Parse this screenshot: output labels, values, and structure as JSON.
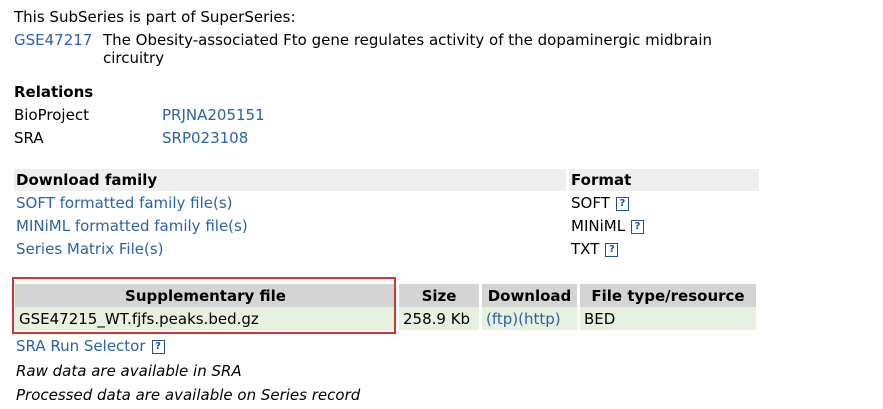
{
  "superseries": {
    "intro": "This SubSeries is part of SuperSeries:",
    "accession": "GSE47217",
    "title_line1": "The Obesity-associated Fto gene regulates activity of the dopaminergic midbrain",
    "title_line2": "circuitry"
  },
  "relations": {
    "heading": "Relations",
    "rows": [
      {
        "label": "BioProject",
        "value": "PRJNA205151"
      },
      {
        "label": "SRA",
        "value": "SRP023108"
      }
    ]
  },
  "download_family": {
    "col_family": "Download family",
    "col_format": "Format",
    "rows": [
      {
        "label": "SOFT formatted family file(s)",
        "format": "SOFT"
      },
      {
        "label": "MINiML formatted family file(s)",
        "format": "MINiML"
      },
      {
        "label": "Series Matrix File(s)",
        "format": "TXT"
      }
    ],
    "help_glyph": "?"
  },
  "supplementary": {
    "headers": [
      "Supplementary file",
      "Size",
      "Download",
      "File type/resource"
    ],
    "rows": [
      {
        "file": "GSE47215_WT.fjfs.peaks.bed.gz",
        "size": "258.9 Kb",
        "ftp": "(ftp)",
        "http": "(http)",
        "type": "BED"
      }
    ]
  },
  "footer": {
    "sra_selector": "SRA Run Selector",
    "raw_note": "Raw data are available in SRA",
    "processed_note": "Processed data are available on Series record"
  },
  "colors": {
    "link": "#2a63a9",
    "highlight_border": "#d23434",
    "header_bg": "#d4d4d4",
    "row_bg": "#e7f1e0"
  }
}
